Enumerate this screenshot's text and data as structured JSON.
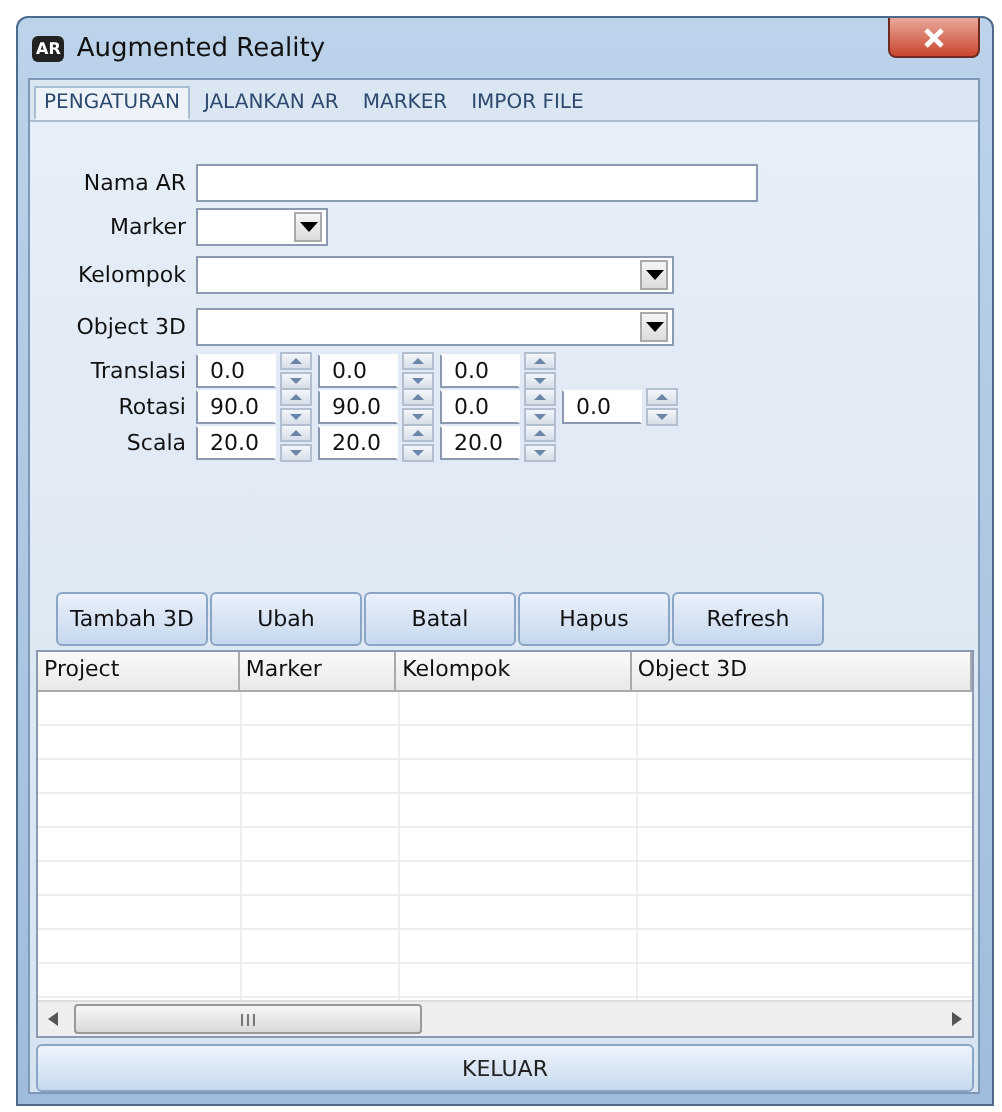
{
  "window": {
    "title": "Augmented Reality",
    "icon_text": "AR"
  },
  "tabs": [
    {
      "label": "PENGATURAN",
      "selected": true
    },
    {
      "label": "JALANKAN AR",
      "selected": false
    },
    {
      "label": "MARKER",
      "selected": false
    },
    {
      "label": "IMPOR FILE",
      "selected": false
    }
  ],
  "form": [
    {
      "label": "Nama AR",
      "kind": "text"
    },
    {
      "label": "Marker",
      "kind": "combo-short"
    },
    {
      "label": "Kelompok",
      "kind": "combo"
    },
    {
      "label": "Object 3D",
      "kind": "combo"
    },
    {
      "label": "Translasi",
      "kind": "spinners",
      "values": [
        "0.0",
        "0.0",
        "0.0"
      ]
    },
    {
      "label": "Rotasi",
      "kind": "spinners",
      "values": [
        "90.0",
        "90.0",
        "0.0",
        "0.0"
      ]
    },
    {
      "label": "Scala",
      "kind": "spinners",
      "values": [
        "20.0",
        "20.0",
        "20.0"
      ]
    }
  ],
  "buttons": [
    "Tambah 3D",
    "Ubah",
    "Batal",
    "Hapus",
    "Refresh"
  ],
  "table": {
    "columns": [
      "Project",
      "Marker",
      "Kelompok",
      "Object 3D"
    ]
  },
  "footer_button": "KELUAR"
}
